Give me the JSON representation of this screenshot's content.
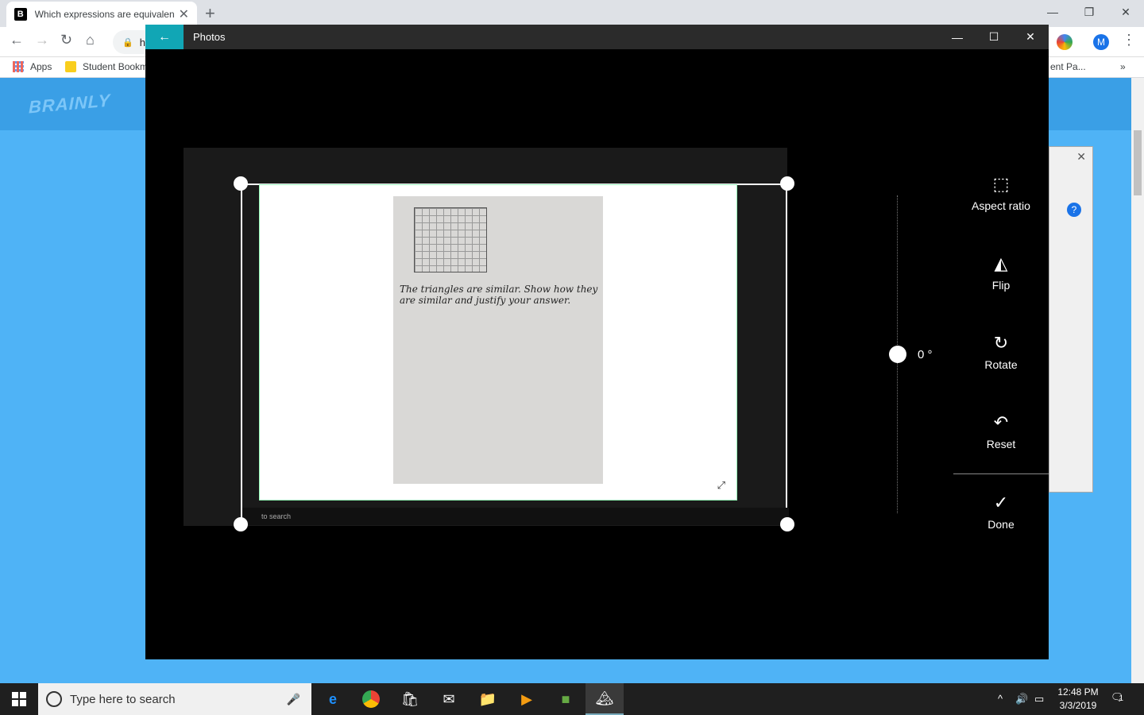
{
  "browser": {
    "tab_title": "Which expressions are equivalent",
    "tab_favicon": "B",
    "url_partial": "h",
    "bookmarks": [
      "Apps",
      "Student Bookm"
    ],
    "bookmark_right": "ent Pa...",
    "profile_initial": "M"
  },
  "brainly": {
    "logo": "BRAINLY"
  },
  "photos": {
    "title": "Photos",
    "rotation_label": "0 °",
    "tools": [
      {
        "label": "Aspect ratio",
        "icon": "aspect-ratio-icon"
      },
      {
        "label": "Flip",
        "icon": "flip-icon"
      },
      {
        "label": "Rotate",
        "icon": "rotate-icon"
      },
      {
        "label": "Reset",
        "icon": "reset-icon"
      },
      {
        "label": "Done",
        "icon": "done-icon"
      }
    ],
    "image_text": "The triangles are similar. Show how they are similar and justify your answer.",
    "inner_taskbar": "to search"
  },
  "taskbar": {
    "search_placeholder": "Type here to search",
    "time": "12:48 PM",
    "date": "3/3/2019",
    "notifications": "1"
  }
}
